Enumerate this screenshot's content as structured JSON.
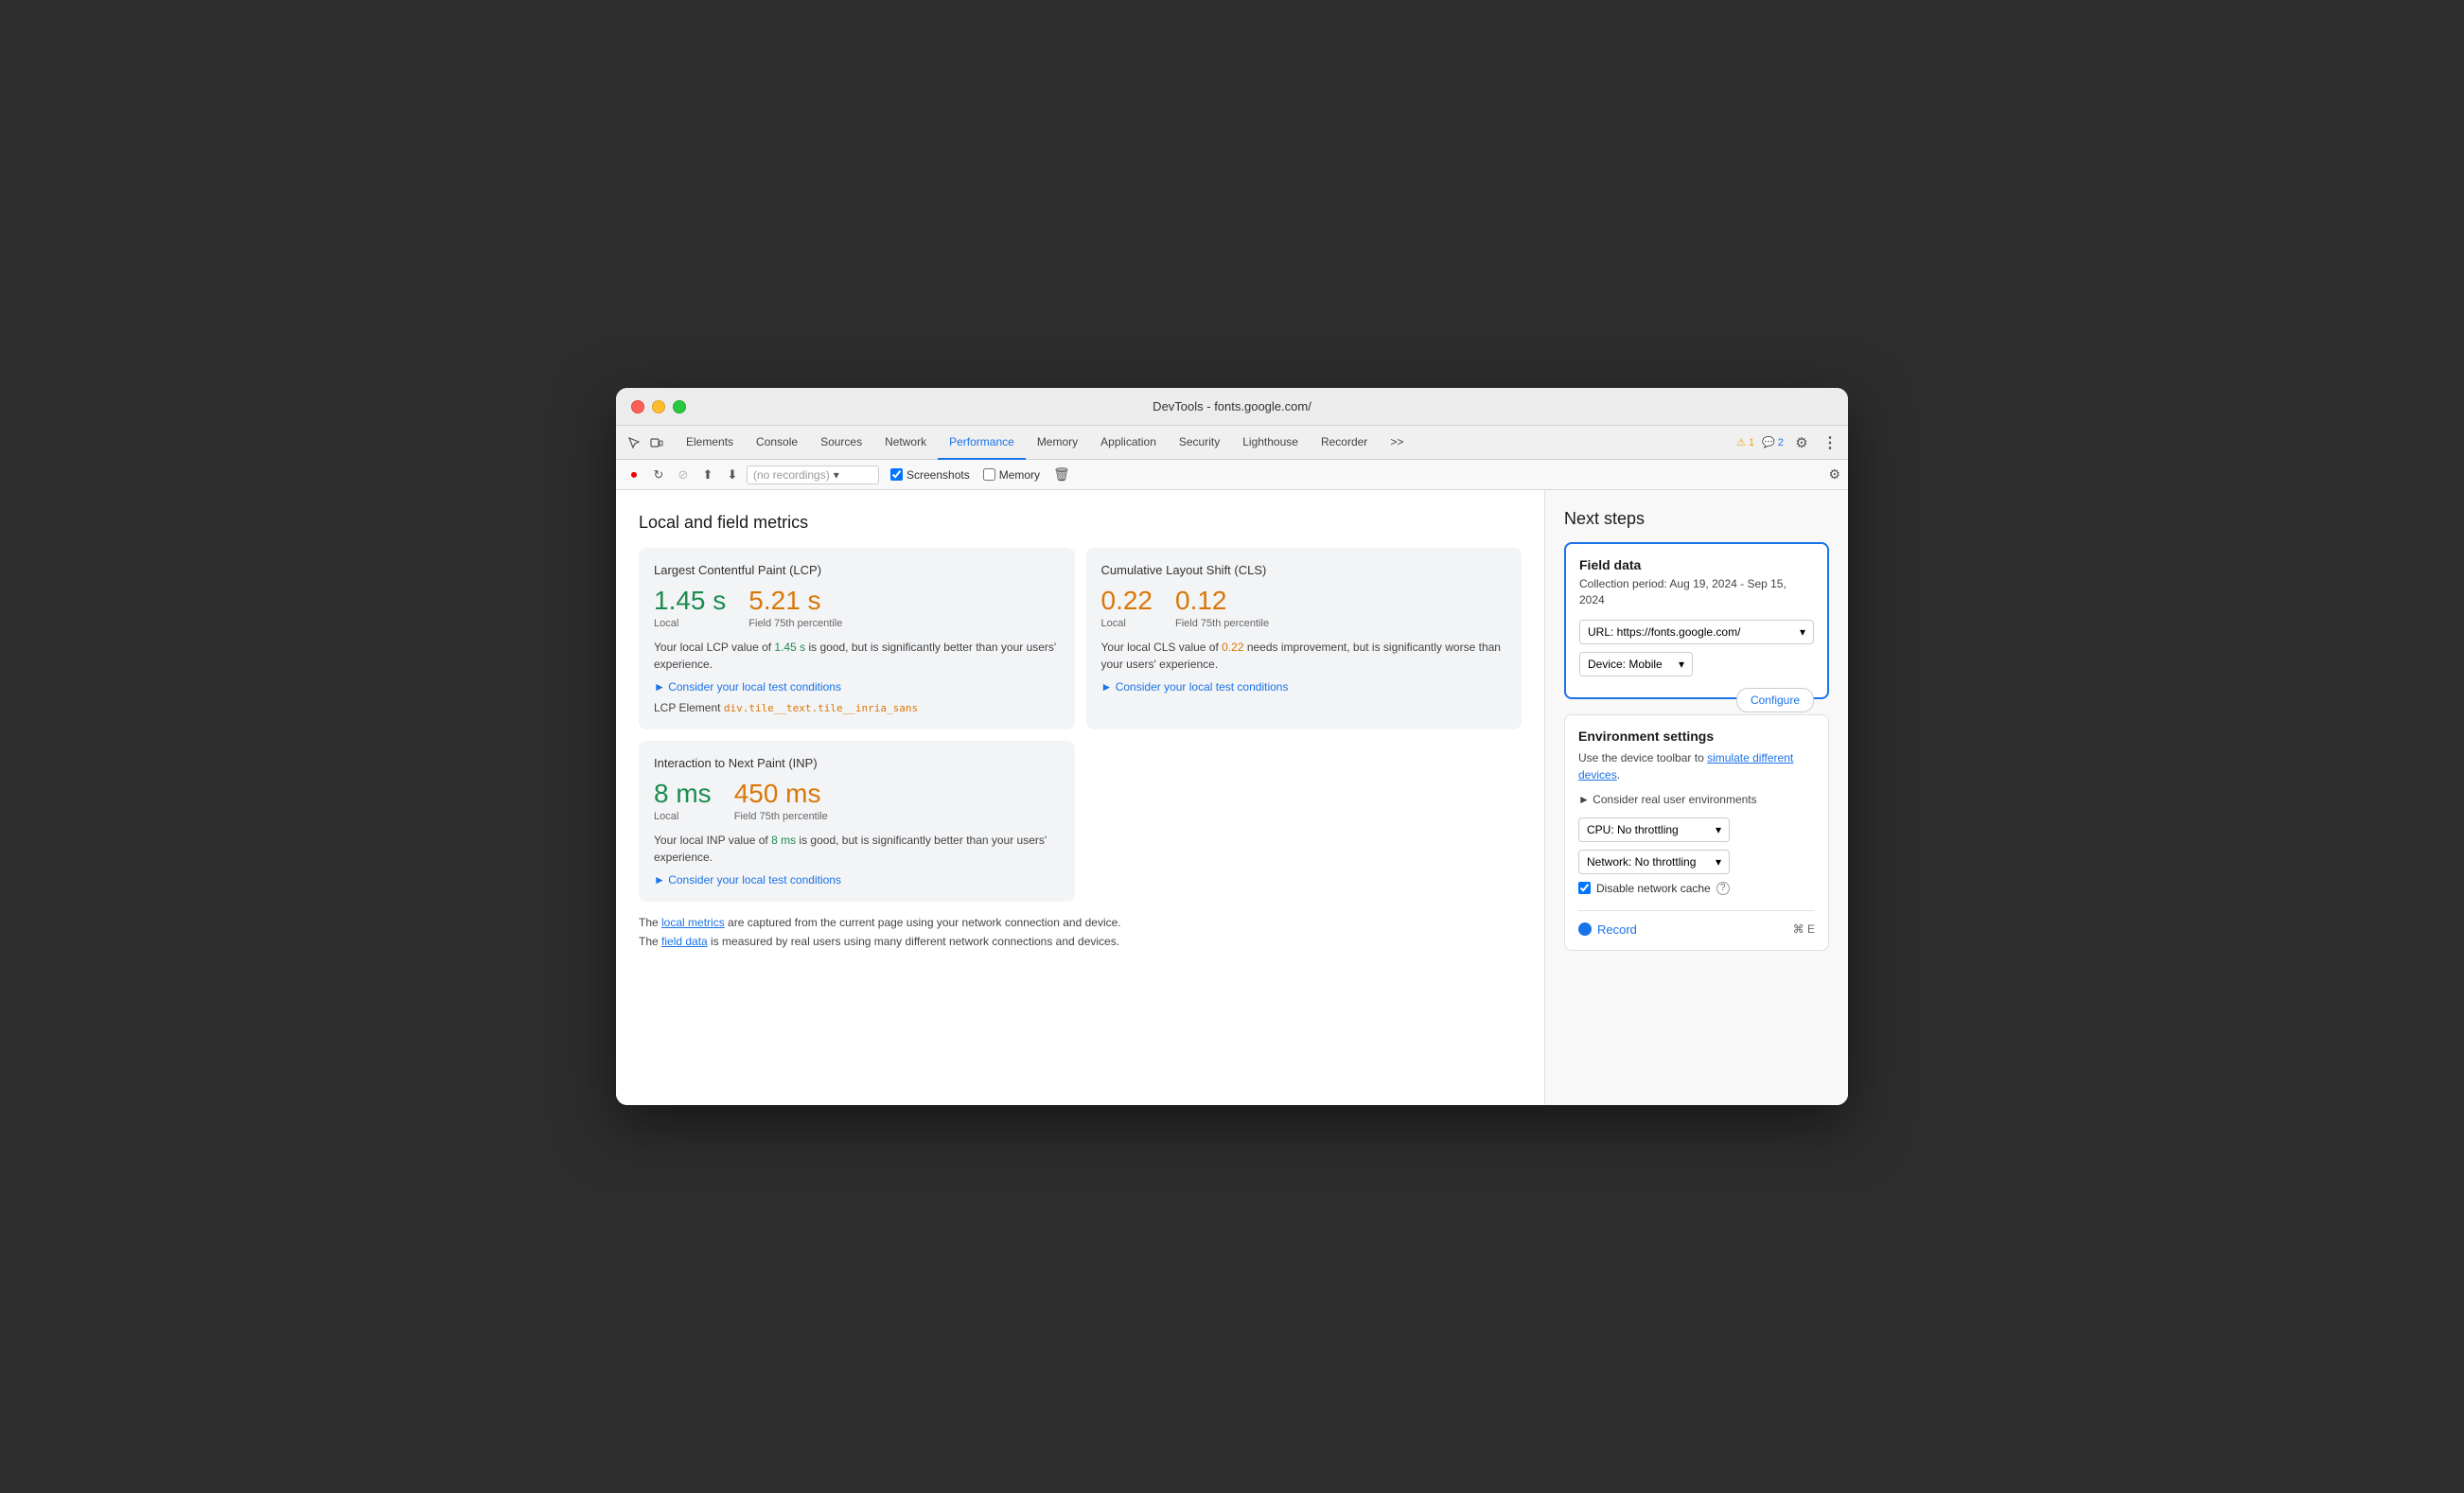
{
  "window": {
    "title": "DevTools - fonts.google.com/"
  },
  "nav": {
    "tabs": [
      {
        "id": "elements",
        "label": "Elements",
        "active": false
      },
      {
        "id": "console",
        "label": "Console",
        "active": false
      },
      {
        "id": "sources",
        "label": "Sources",
        "active": false
      },
      {
        "id": "network",
        "label": "Network",
        "active": false
      },
      {
        "id": "performance",
        "label": "Performance",
        "active": true
      },
      {
        "id": "memory",
        "label": "Memory",
        "active": false
      },
      {
        "id": "application",
        "label": "Application",
        "active": false
      },
      {
        "id": "security",
        "label": "Security",
        "active": false
      },
      {
        "id": "lighthouse",
        "label": "Lighthouse",
        "active": false
      },
      {
        "id": "recorder",
        "label": "Recorder",
        "active": false
      }
    ],
    "overflow": ">>",
    "warnings": "1",
    "infos": "2"
  },
  "secondary_toolbar": {
    "recording_placeholder": "(no recordings)",
    "screenshots_label": "Screenshots",
    "screenshots_checked": true,
    "memory_label": "Memory",
    "memory_checked": false
  },
  "left_panel": {
    "section_title": "Local and field metrics",
    "lcp_card": {
      "title": "Largest Contentful Paint (LCP)",
      "local_value": "1.45 s",
      "local_label": "Local",
      "field_value": "5.21 s",
      "field_label": "Field 75th percentile",
      "description_before": "Your local LCP value of ",
      "description_highlight": "1.45 s",
      "description_after": " is good, but is significantly better than your users' experience.",
      "consider_label": "► Consider your local test conditions",
      "lcp_element_label": "LCP Element",
      "lcp_element_value": "div.tile__text.tile__inria_sans"
    },
    "cls_card": {
      "title": "Cumulative Layout Shift (CLS)",
      "local_value": "0.22",
      "local_label": "Local",
      "field_value": "0.12",
      "field_label": "Field 75th percentile",
      "description_before": "Your local CLS value of ",
      "description_highlight": "0.22",
      "description_after": " needs improvement, but is significantly worse than your users' experience.",
      "consider_label": "► Consider your local test conditions"
    },
    "inp_card": {
      "title": "Interaction to Next Paint (INP)",
      "local_value": "8 ms",
      "local_label": "Local",
      "field_value": "450 ms",
      "field_label": "Field 75th percentile",
      "description_before": "Your local INP value of ",
      "description_highlight": "8 ms",
      "description_after": " is good, but is significantly better than your users' experience.",
      "consider_label": "► Consider your local test conditions"
    },
    "footer": {
      "line1_before": "The ",
      "line1_link": "local metrics",
      "line1_after": " are captured from the current page using your network connection and device.",
      "line2_before": "The ",
      "line2_link": "field data",
      "line2_after": " is measured by real users using many different network connections and devices."
    }
  },
  "right_panel": {
    "title": "Next steps",
    "field_data": {
      "title": "Field data",
      "period": "Collection period: Aug 19, 2024 - Sep 15, 2024",
      "url_label": "URL: https://fonts.google.com/",
      "device_label": "Device: Mobile",
      "configure_label": "Configure"
    },
    "env_settings": {
      "title": "Environment settings",
      "desc_before": "Use the device toolbar to ",
      "desc_link": "simulate different devices",
      "desc_after": ".",
      "consider_label": "► Consider real user environments",
      "cpu_label": "CPU: No throttling",
      "network_label": "Network: No throttling",
      "disable_cache_label": "Disable network cache"
    },
    "record": {
      "label": "Record",
      "shortcut": "⌘ E"
    }
  }
}
